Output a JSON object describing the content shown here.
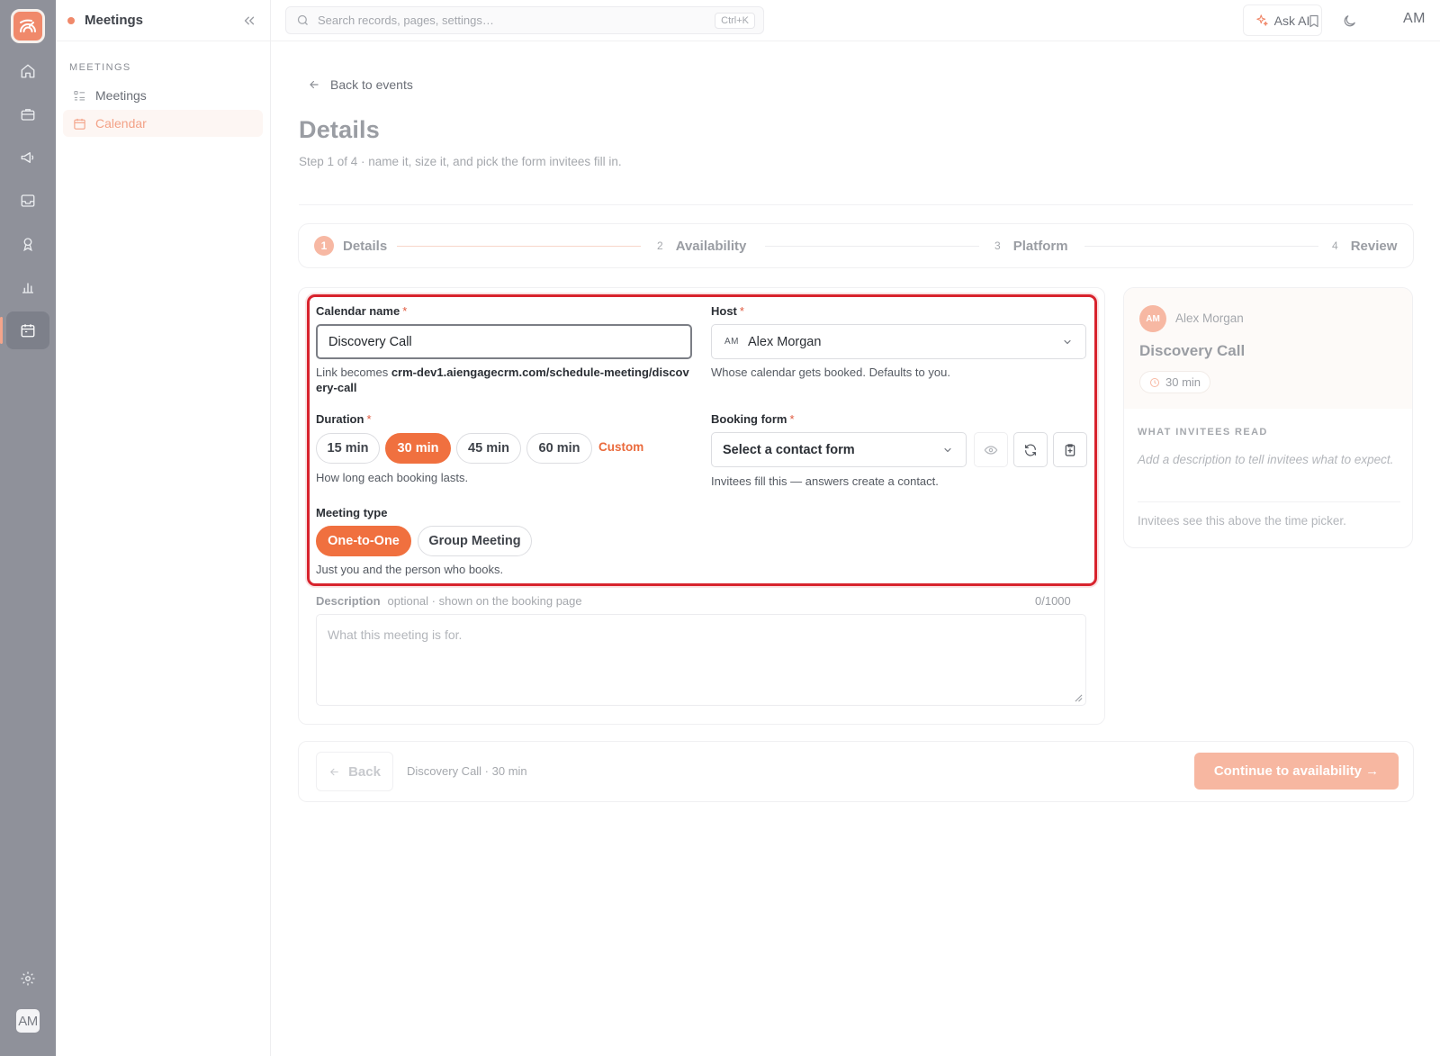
{
  "rail": {
    "icons": [
      "home-icon",
      "briefcase-icon",
      "megaphone-icon",
      "inbox-icon",
      "award-icon",
      "bar-chart-icon",
      "calendar-icon"
    ],
    "active": "calendar-icon",
    "user_initials": "AM"
  },
  "sidebar": {
    "title": "Meetings",
    "section": "MEETINGS",
    "items": [
      {
        "label": "Meetings",
        "icon": "list-icon"
      },
      {
        "label": "Calendar",
        "icon": "calendar-icon",
        "active": true
      }
    ]
  },
  "topbar": {
    "search_placeholder": "Search records, pages, settings…",
    "shortcut": "Ctrl+K",
    "ask_ai": "Ask AI",
    "user_initials": "AM"
  },
  "page": {
    "back_label": "Back to events",
    "title": "Details",
    "subtitle": "Step 1 of 4 · name it, size it, and pick the form invitees fill in."
  },
  "stepper": {
    "steps": [
      {
        "num": "1",
        "label": "Details",
        "active": true
      },
      {
        "num": "2",
        "label": "Availability"
      },
      {
        "num": "3",
        "label": "Platform"
      },
      {
        "num": "4",
        "label": "Review"
      }
    ]
  },
  "form": {
    "name": {
      "label": "Calendar name",
      "required": "*",
      "value": "Discovery Call",
      "hint_prefix": "Link becomes ",
      "hint_link": "crm-dev1.aiengagecrm.com/schedule-meeting/discovery-call"
    },
    "host": {
      "label": "Host",
      "required": "*",
      "initials": "AM",
      "value": "Alex Morgan",
      "hint": "Whose calendar gets booked. Defaults to you."
    },
    "duration": {
      "label": "Duration",
      "required": "*",
      "options": [
        "15 min",
        "30 min",
        "45 min",
        "60 min"
      ],
      "selected": "30 min",
      "custom": "Custom",
      "hint": "How long each booking lasts."
    },
    "booking_form": {
      "label": "Booking form",
      "required": "*",
      "placeholder": "Select a contact form",
      "hint": "Invitees fill this — answers create a contact."
    },
    "meeting_type": {
      "label": "Meeting type",
      "options": [
        "One-to-One",
        "Group Meeting"
      ],
      "selected": "One-to-One",
      "hint": "Just you and the person who books."
    },
    "description": {
      "label": "Description",
      "meta": "optional · shown on the booking page",
      "count": "0/1000",
      "placeholder": "What this meeting is for."
    }
  },
  "footer": {
    "back": "Back",
    "summary": "Discovery Call · 30 min",
    "continue": "Continue to availability →"
  },
  "preview": {
    "initials": "AM",
    "host": "Alex Morgan",
    "title": "Discovery Call",
    "duration": "30 min",
    "section": "WHAT INVITEES READ",
    "desc_placeholder": "Add a description to tell invitees what to expect.",
    "note": "Invitees see this above the time picker."
  },
  "colors": {
    "accent": "#f0703f",
    "accent_soft": "#f7b7a1",
    "focus_outline": "#d8232d",
    "rail": "#8f919a"
  }
}
